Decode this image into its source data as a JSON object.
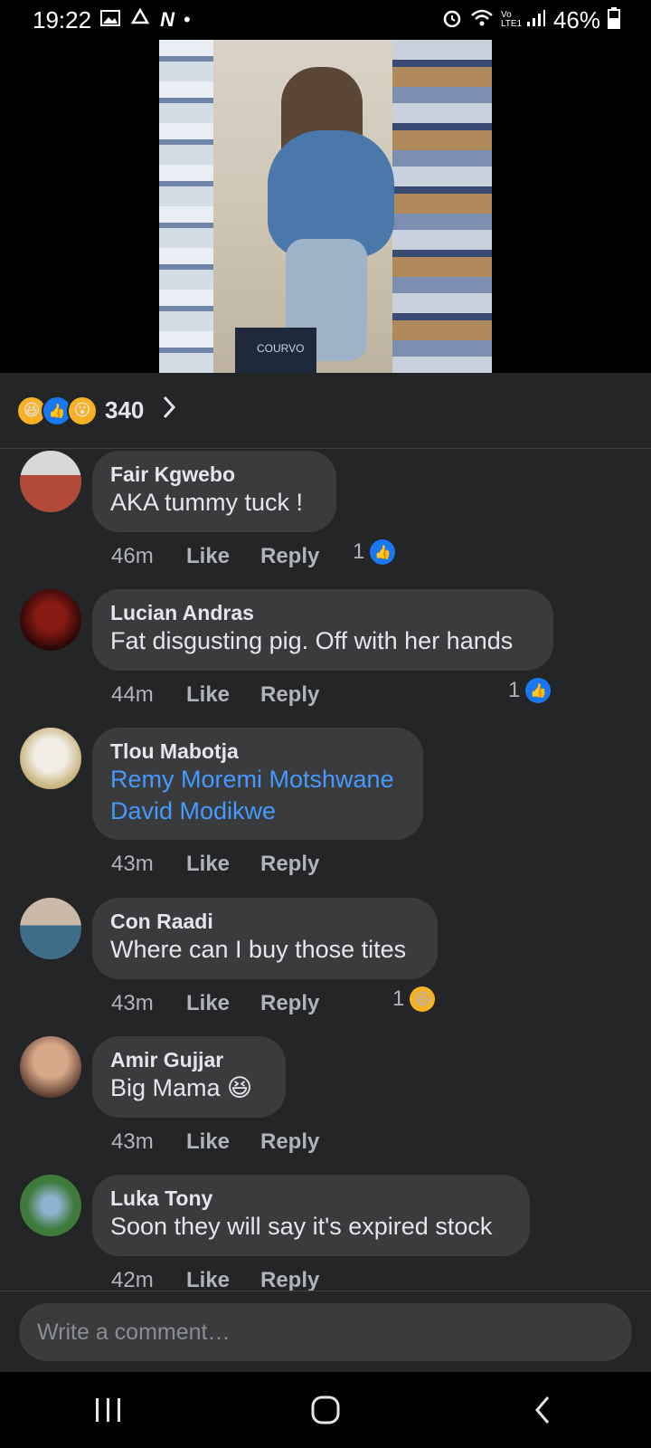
{
  "status_bar": {
    "time": "19:22",
    "network_label": "Vo LTE1",
    "battery": "46%",
    "icons": [
      "gallery-icon",
      "sync-icon",
      "n-app-icon",
      "dot-icon",
      "alarm-icon",
      "wifi-icon",
      "signal-icon",
      "battery-charging-icon"
    ]
  },
  "video": {
    "description_icon": "video-thumbnail",
    "sign_text": "COURVO"
  },
  "reactions": {
    "icons": [
      "haha-icon",
      "like-icon",
      "wow-icon"
    ],
    "count": "340"
  },
  "comments": [
    {
      "author": "Fair Kgwebo",
      "text": "AKA tummy tuck !",
      "time": "46m",
      "like": "Like",
      "reply": "Reply",
      "reaction_count": "1",
      "reaction_icon": "like-icon"
    },
    {
      "author": "Lucian Andras",
      "text": "Fat disgusting pig. Off with her hands",
      "time": "44m",
      "like": "Like",
      "reply": "Reply",
      "reaction_count": "1",
      "reaction_icon": "like-icon"
    },
    {
      "author": "Tlou Mabotja",
      "mentions": [
        "Remy Moremi Motshwane",
        "David Modikwe"
      ],
      "time": "43m",
      "like": "Like",
      "reply": "Reply"
    },
    {
      "author": "Con Raadi",
      "text": "Where can I buy those tites",
      "time": "43m",
      "like": "Like",
      "reply": "Reply",
      "reaction_count": "1",
      "reaction_icon": "haha-icon"
    },
    {
      "author": "Amir Gujjar",
      "text": "Big Mama 😆",
      "time": "43m",
      "like": "Like",
      "reply": "Reply"
    },
    {
      "author": "Luka Tony",
      "text": "Soon they will say it's expired stock",
      "time": "42m",
      "like": "Like",
      "reply": "Reply"
    }
  ],
  "composer": {
    "placeholder": "Write a comment…"
  },
  "nav": {
    "icons": [
      "recent-apps-icon",
      "home-icon",
      "back-icon"
    ]
  },
  "colors": {
    "background": "#242526",
    "bubble": "#3a3b3c",
    "mention": "#4599ff",
    "like_blue": "#1877f2",
    "haha_yellow": "#f7b125"
  }
}
